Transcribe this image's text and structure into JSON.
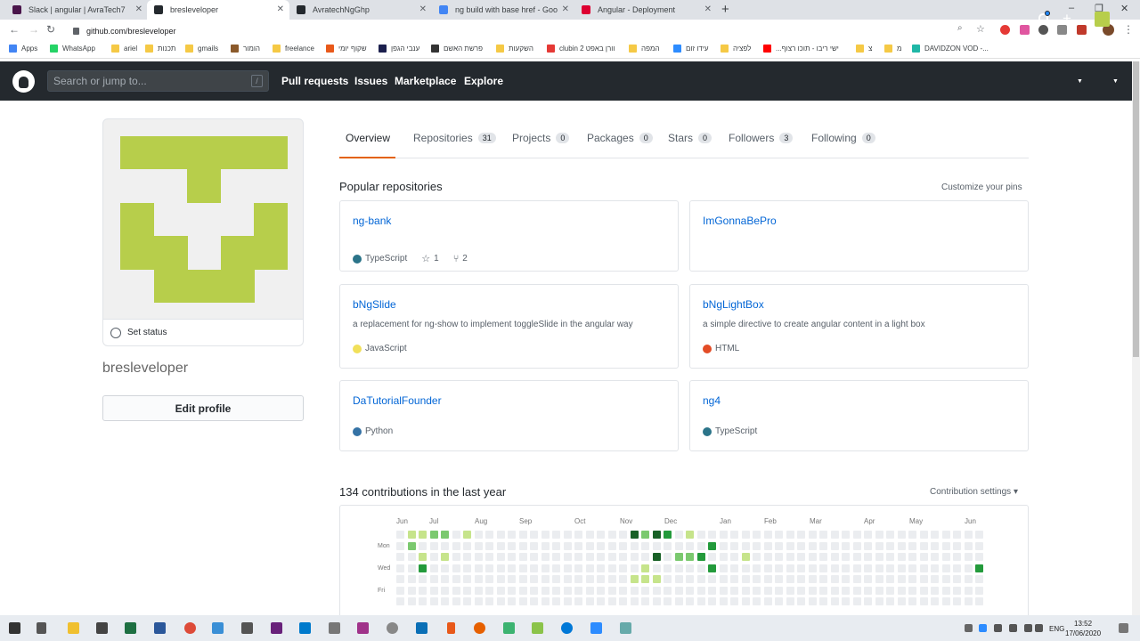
{
  "browser": {
    "tabs": [
      {
        "title": "Slack | angular | AvraTech7",
        "color": "#4a154b"
      },
      {
        "title": "bresleveloper",
        "color": "#24292e"
      },
      {
        "title": "AvratechNgGhp",
        "color": "#24292e"
      },
      {
        "title": "ng build with base href - Google",
        "color": "#4285f4"
      },
      {
        "title": "Angular - Deployment",
        "color": "#dd0031"
      }
    ],
    "url": "github.com/bresleveloper",
    "bookmarks": [
      {
        "label": "Apps",
        "color": "#4285f4"
      },
      {
        "label": "WhatsApp",
        "color": "#25d366"
      },
      {
        "label": "ariel",
        "color": "#f5c945"
      },
      {
        "label": "תכנות",
        "color": "#f5c945"
      },
      {
        "label": "gmails",
        "color": "#f5c945"
      },
      {
        "label": "הומור",
        "color": "#8b5a2b"
      },
      {
        "label": "freelance",
        "color": "#f5c945"
      },
      {
        "label": "שקוף יומי",
        "color": "#e8591a"
      },
      {
        "label": "ענבי הגפן",
        "color": "#1b1f4d"
      },
      {
        "label": "פרשת האשם",
        "color": "#333"
      },
      {
        "label": "השקעות",
        "color": "#f5c945"
      },
      {
        "label": "clubin 2 וורן באפט",
        "color": "#e53935"
      },
      {
        "label": "המפה",
        "color": "#f5c945"
      },
      {
        "label": "עידו זום",
        "color": "#2d8cff"
      },
      {
        "label": "לפציה",
        "color": "#f5c945"
      },
      {
        "label": "...ישי ריבו - תוכו רצוף",
        "color": "#ff0000"
      },
      {
        "label": "צ",
        "color": "#f5c945"
      },
      {
        "label": "מ",
        "color": "#f5c945"
      },
      {
        "label": "DAVIDZON VOD -...",
        "color": "#1fb7a6"
      }
    ]
  },
  "header": {
    "search_placeholder": "Search or jump to...",
    "slash": "/",
    "nav": [
      "Pull requests",
      "Issues",
      "Marketplace",
      "Explore"
    ]
  },
  "profile": {
    "username": "bresleveloper",
    "set_status": "Set status",
    "edit_profile": "Edit profile"
  },
  "tabs": [
    {
      "label": "Overview",
      "count": ""
    },
    {
      "label": "Repositories",
      "count": "31"
    },
    {
      "label": "Projects",
      "count": "0"
    },
    {
      "label": "Packages",
      "count": "0"
    },
    {
      "label": "Stars",
      "count": "0"
    },
    {
      "label": "Followers",
      "count": "3"
    },
    {
      "label": "Following",
      "count": "0"
    }
  ],
  "popular": {
    "heading": "Popular repositories",
    "customize": "Customize your pins",
    "repos": [
      {
        "name": "ng-bank",
        "description": "",
        "language": "TypeScript",
        "lang_color": "#2b7489",
        "stars": "1",
        "forks": "2"
      },
      {
        "name": "ImGonnaBePro",
        "description": "",
        "language": "",
        "lang_color": "",
        "stars": "",
        "forks": ""
      },
      {
        "name": "bNgSlide",
        "description": "a replacement for ng-show to implement toggleSlide in the angular way",
        "language": "JavaScript",
        "lang_color": "#f1e05a",
        "stars": "",
        "forks": ""
      },
      {
        "name": "bNgLightBox",
        "description": "a simple directive to create angular content in a light box",
        "language": "HTML",
        "lang_color": "#e34c26",
        "stars": "",
        "forks": ""
      },
      {
        "name": "DaTutorialFounder",
        "description": "",
        "language": "Python",
        "lang_color": "#3572a5",
        "stars": "",
        "forks": ""
      },
      {
        "name": "ng4",
        "description": "",
        "language": "TypeScript",
        "lang_color": "#2b7489",
        "stars": "",
        "forks": ""
      }
    ]
  },
  "contributions": {
    "heading": "134 contributions in the last year",
    "settings": "Contribution settings ▾",
    "months": [
      "Jun",
      "Jul",
      "Aug",
      "Sep",
      "Oct",
      "Nov",
      "Dec",
      "Jan",
      "Feb",
      "Mar",
      "Apr",
      "May",
      "Jun"
    ],
    "days": [
      "Mon",
      "Wed",
      "Fri"
    ],
    "levels": [
      "#ebedf0",
      "#c6e48b",
      "#7bc96f",
      "#239a3b",
      "#196127"
    ],
    "active_cells": [
      [
        1,
        0,
        1
      ],
      [
        2,
        0,
        1
      ],
      [
        3,
        0,
        2
      ],
      [
        4,
        0,
        2
      ],
      [
        6,
        0,
        1
      ],
      [
        1,
        1,
        2
      ],
      [
        2,
        2,
        1
      ],
      [
        4,
        2,
        1
      ],
      [
        2,
        3,
        3
      ],
      [
        21,
        0,
        4
      ],
      [
        22,
        0,
        2
      ],
      [
        23,
        0,
        4
      ],
      [
        24,
        0,
        3
      ],
      [
        26,
        0,
        1
      ],
      [
        28,
        1,
        3
      ],
      [
        23,
        2,
        4
      ],
      [
        25,
        2,
        2
      ],
      [
        26,
        2,
        2
      ],
      [
        27,
        2,
        3
      ],
      [
        22,
        3,
        1
      ],
      [
        28,
        3,
        3
      ],
      [
        31,
        2,
        1
      ],
      [
        21,
        4,
        1
      ],
      [
        22,
        4,
        1
      ],
      [
        23,
        4,
        1
      ],
      [
        52,
        3,
        3
      ]
    ]
  },
  "taskbar": {
    "language": "ENG",
    "time": "13:52",
    "date": "17/06/2020"
  }
}
